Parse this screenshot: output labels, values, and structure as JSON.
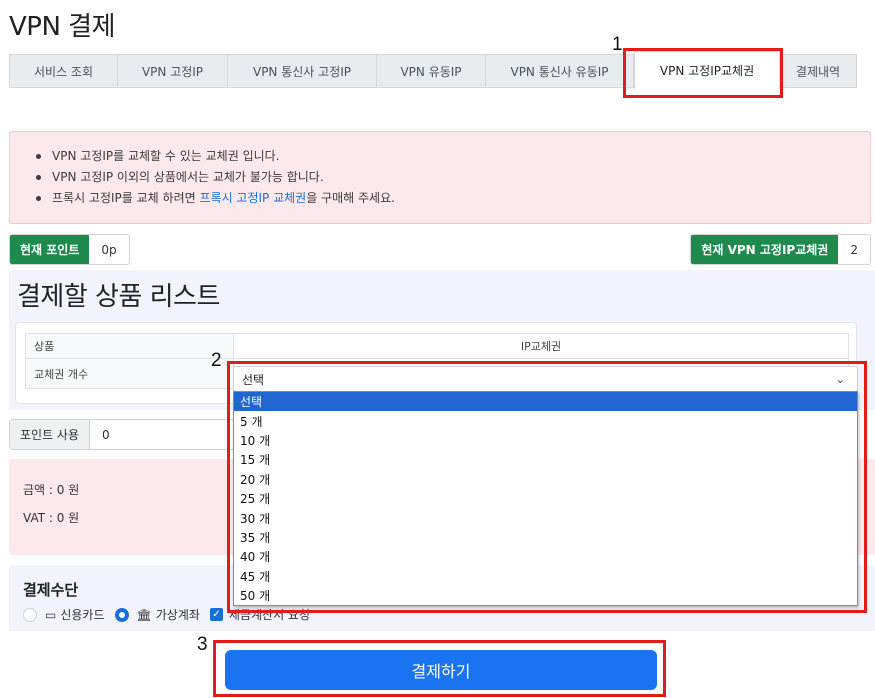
{
  "page": {
    "title": "VPN 결제"
  },
  "tabs": [
    {
      "label": "서비스 조회"
    },
    {
      "label": "VPN 고정IP"
    },
    {
      "label": "VPN 통신사 고정IP"
    },
    {
      "label": "VPN 유동IP"
    },
    {
      "label": "VPN 통신사 유동IP"
    },
    {
      "label": "VPN 고정IP교체권",
      "active": true
    },
    {
      "label": "결제내역"
    }
  ],
  "annotations": {
    "one": "1",
    "two": "2",
    "three": "3"
  },
  "notice": {
    "items": [
      "VPN 고정IP를 교체할 수 있는 교체권 입니다.",
      "VPN 고정IP 이외의 상품에서는 교체가 불가능 합니다."
    ],
    "proxy_prefix": "프록시 고정IP를 교체 하려면 ",
    "proxy_link": "프록시 고정IP 교체권",
    "proxy_suffix": "을 구매해 주세요."
  },
  "points": {
    "label": "현재 포인트",
    "value": "0p"
  },
  "tickets": {
    "label": "현재 VPN 고정IP교체권",
    "value": "2"
  },
  "product_list": {
    "title": "결제할 상품 리스트",
    "product_label": "상품",
    "product_value": "IP교체권",
    "count_label": "교체권 개수"
  },
  "select": {
    "value": "선택",
    "options": [
      "선택",
      "5 개",
      "10 개",
      "15 개",
      "20 개",
      "25 개",
      "30 개",
      "35 개",
      "40 개",
      "45 개",
      "50 개"
    ]
  },
  "point_use": {
    "label": "포인트 사용",
    "value": "0"
  },
  "amount": {
    "price": "금액 : 0 원",
    "vat": "VAT : 0 원"
  },
  "payment": {
    "title": "결제수단",
    "credit_card": "신용카드",
    "virtual_account": "가상계좌",
    "tax_invoice": "세금계산서 요청"
  },
  "pay_button": "결제하기"
}
